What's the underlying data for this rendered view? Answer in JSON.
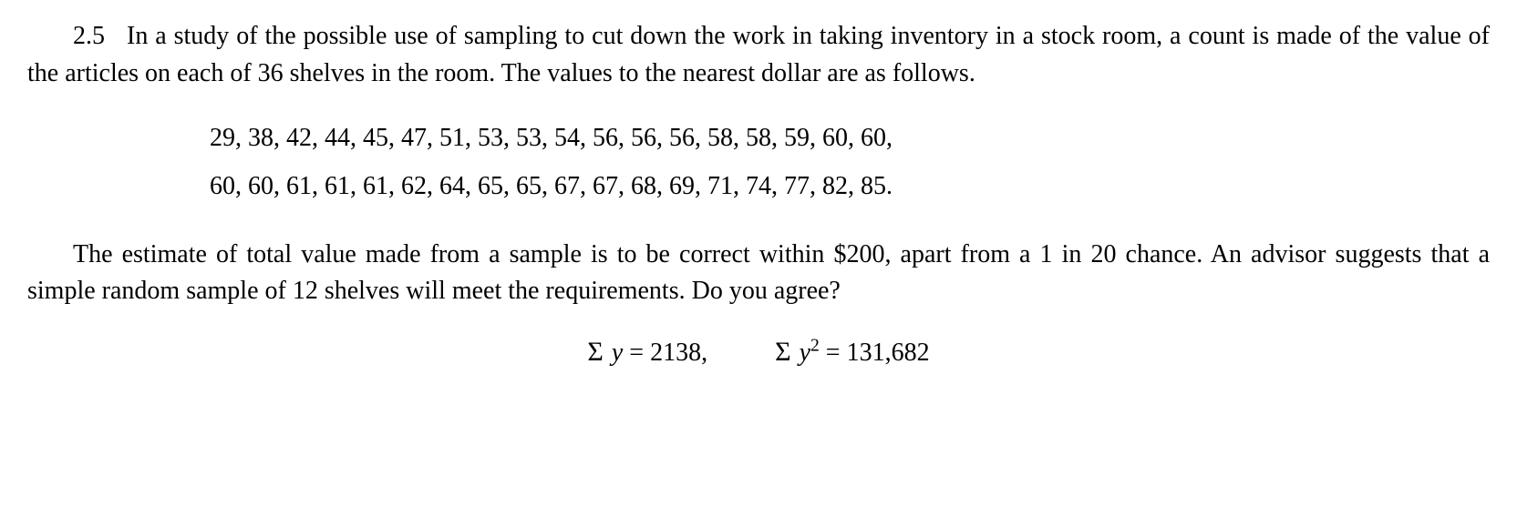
{
  "problem": {
    "number": "2.5",
    "para1_a": "In a study of the possible use of sampling to cut down the work in taking inventory in a stock room, a count is made of the value of the articles on each of 36 shelves in the room. The values to the nearest dollar are as follows.",
    "data_line1": "29, 38, 42, 44, 45, 47, 51, 53, 53, 54, 56, 56, 56, 58, 58, 59, 60, 60,",
    "data_line2": "60, 60, 61, 61, 61, 62, 64, 65, 65, 67, 67, 68, 69, 71, 74, 77, 82, 85.",
    "para2": "The estimate of total value made from a sample is to be correct within $200, apart from a 1 in 20 chance. An advisor suggests that a simple random sample of 12 shelves will meet the requirements. Do you agree?",
    "eq": {
      "sum_y_label_sigma": "Σ",
      "sum_y_var": "y",
      "sum_y_eq": " = 2138,",
      "sum_y2_var": "y",
      "sum_y2_sup": "2",
      "sum_y2_eq": " = 131,682"
    }
  }
}
